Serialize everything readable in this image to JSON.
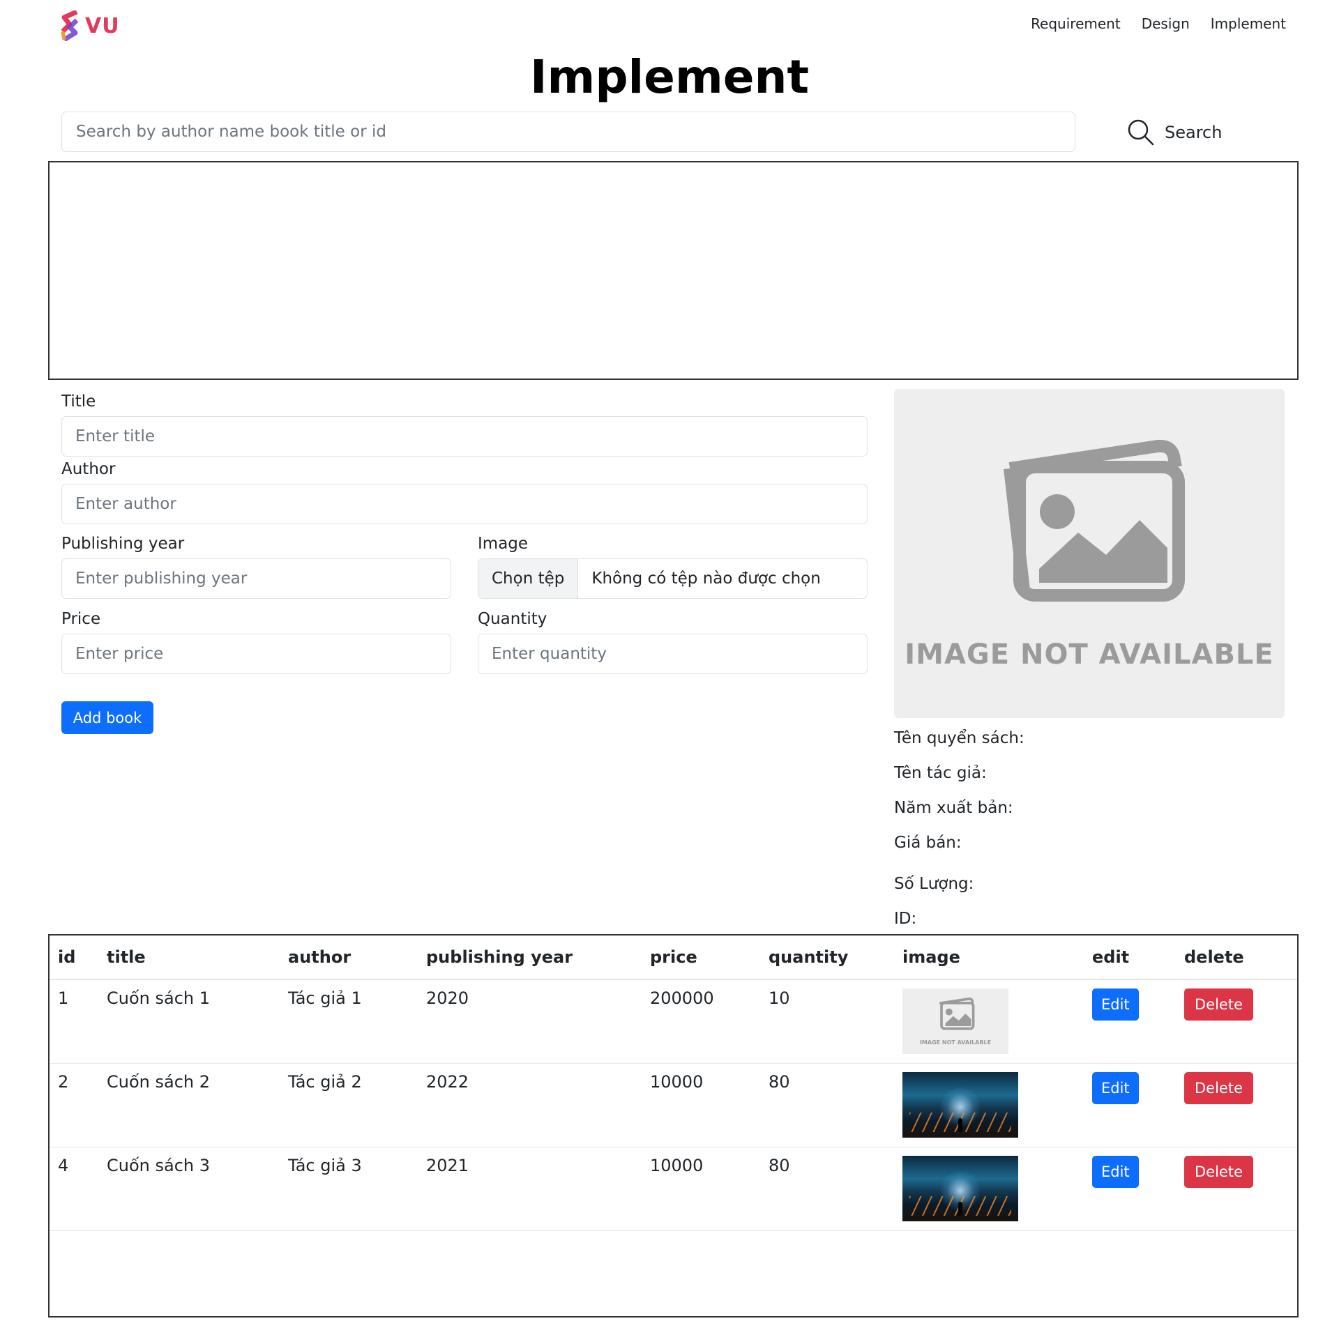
{
  "header": {
    "logo_text": "VU",
    "nav": [
      "Requirement",
      "Design",
      "Implement"
    ]
  },
  "page": {
    "title": "Implement"
  },
  "search": {
    "placeholder": "Search by author name book title or id",
    "value": "",
    "button_label": "Search"
  },
  "form": {
    "title_label": "Title",
    "title_placeholder": "Enter title",
    "author_label": "Author",
    "author_placeholder": "Enter author",
    "year_label": "Publishing year",
    "year_placeholder": "Enter publishing year",
    "image_label": "Image",
    "file_button": "Chọn tệp",
    "file_status": "Không có tệp nào được chọn",
    "price_label": "Price",
    "price_placeholder": "Enter price",
    "quantity_label": "Quantity",
    "quantity_placeholder": "Enter quantity",
    "submit_label": "Add book"
  },
  "preview": {
    "image_text": "IMAGE NOT AVAILABLE",
    "fields": [
      "Tên quyển sách:",
      "Tên tác giả:",
      "Năm xuất bản:",
      "Giá bán:",
      "Số Lượng:",
      "ID:"
    ]
  },
  "table": {
    "headers": [
      "id",
      "title",
      "author",
      "publishing year",
      "price",
      "quantity",
      "image",
      "edit",
      "delete"
    ],
    "rows": [
      {
        "id": "1",
        "title": "Cuốn sách 1",
        "author": "Tác giả 1",
        "year": "2020",
        "price": "200000",
        "quantity": "10",
        "image": "image-not-available",
        "image_text": "IMAGE NOT AVAILABLE"
      },
      {
        "id": "2",
        "title": "Cuốn sách 2",
        "author": "Tác giả 2",
        "year": "2022",
        "price": "10000",
        "quantity": "80",
        "image": "sci-fi-landscape"
      },
      {
        "id": "4",
        "title": "Cuốn sách 3",
        "author": "Tác giả 3",
        "year": "2021",
        "price": "10000",
        "quantity": "80",
        "image": "sci-fi-landscape"
      }
    ],
    "edit_label": "Edit",
    "delete_label": "Delete"
  },
  "colors": {
    "primary": "#0d6efd",
    "danger": "#dc3545",
    "logo": "#e23a5b"
  }
}
